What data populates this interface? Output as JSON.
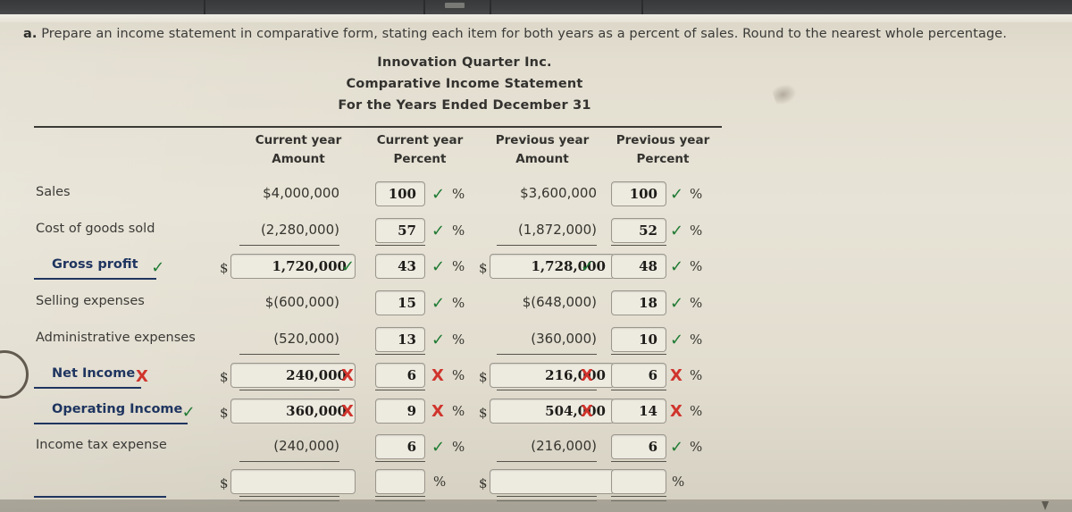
{
  "question": {
    "label": "a.",
    "text": "Prepare an income statement in comparative form, stating each item for both years as a percent of sales. Round to the nearest whole percentage."
  },
  "statement": {
    "company": "Innovation Quarter Inc.",
    "title": "Comparative Income Statement",
    "period": "For the Years Ended December 31",
    "columns": [
      {
        "line1": "Current year",
        "line2": "Amount"
      },
      {
        "line1": "Current year",
        "line2": "Percent"
      },
      {
        "line1": "Previous year",
        "line2": "Amount"
      },
      {
        "line1": "Previous year",
        "line2": "Percent"
      }
    ]
  },
  "symbols": {
    "dollar": "$",
    "percent": "%",
    "check": "✓",
    "cross": "X"
  },
  "rows": [
    {
      "label": "Sales",
      "bold": false,
      "cur_amount_text": "$4,000,000",
      "cur_amount_input": null,
      "cur_amount_mark": null,
      "cur_percent_input": "100",
      "cur_percent_mark": "check",
      "prev_amount_text": "$3,600,000",
      "prev_amount_input": null,
      "prev_amount_mark": null,
      "prev_percent_input": "100",
      "prev_percent_mark": "check"
    },
    {
      "label": "Cost of goods sold",
      "bold": false,
      "cur_amount_text": "(2,280,000)",
      "cur_amount_input": null,
      "cur_amount_mark": null,
      "cur_percent_input": "57",
      "cur_percent_mark": "check",
      "prev_amount_text": "(1,872,000)",
      "prev_amount_input": null,
      "prev_amount_mark": null,
      "prev_percent_input": "52",
      "prev_percent_mark": "check"
    },
    {
      "label": "Gross profit",
      "bold": true,
      "label_mark": "check",
      "cur_amount_text": null,
      "cur_amount_input": "1,720,000",
      "cur_amount_mark": "check",
      "cur_percent_input": "43",
      "cur_percent_mark": "check",
      "prev_amount_text": null,
      "prev_amount_input": "1,728,000",
      "prev_amount_mark": "check",
      "prev_percent_input": "48",
      "prev_percent_mark": "check"
    },
    {
      "label": "Selling expenses",
      "bold": false,
      "cur_amount_text": "$(600,000)",
      "cur_amount_input": null,
      "cur_amount_mark": null,
      "cur_percent_input": "15",
      "cur_percent_mark": "check",
      "prev_amount_text": "$(648,000)",
      "prev_amount_input": null,
      "prev_amount_mark": null,
      "prev_percent_input": "18",
      "prev_percent_mark": "check"
    },
    {
      "label": "Administrative expenses",
      "bold": false,
      "cur_amount_text": "(520,000)",
      "cur_amount_input": null,
      "cur_amount_mark": null,
      "cur_percent_input": "13",
      "cur_percent_mark": "check",
      "prev_amount_text": "(360,000)",
      "prev_amount_input": null,
      "prev_amount_mark": null,
      "prev_percent_input": "10",
      "prev_percent_mark": "check"
    },
    {
      "label": "Net Income",
      "bold": true,
      "label_mark": "cross",
      "cur_amount_text": null,
      "cur_amount_input": "240,000",
      "cur_amount_mark": "cross",
      "cur_percent_input": "6",
      "cur_percent_mark": "cross",
      "prev_amount_text": null,
      "prev_amount_input": "216,000",
      "prev_amount_mark": "cross",
      "prev_percent_input": "6",
      "prev_percent_mark": "cross"
    },
    {
      "label": "Operating Income",
      "bold": true,
      "label_mark": "check",
      "cur_amount_text": null,
      "cur_amount_input": "360,000",
      "cur_amount_mark": "cross",
      "cur_percent_input": "9",
      "cur_percent_mark": "cross",
      "prev_amount_text": null,
      "prev_amount_input": "504,000",
      "prev_amount_mark": "cross",
      "prev_percent_input": "14",
      "prev_percent_mark": "cross"
    },
    {
      "label": "Income tax expense",
      "bold": false,
      "cur_amount_text": "(240,000)",
      "cur_amount_input": null,
      "cur_amount_mark": null,
      "cur_percent_input": "6",
      "cur_percent_mark": "check",
      "prev_amount_text": "(216,000)",
      "prev_amount_input": null,
      "prev_amount_mark": null,
      "prev_percent_input": "6",
      "prev_percent_mark": "check"
    },
    {
      "label": "",
      "bold": true,
      "label_mark": null,
      "cur_amount_text": null,
      "cur_amount_input": "",
      "cur_amount_mark": null,
      "cur_percent_input": "",
      "cur_percent_mark": null,
      "prev_amount_text": null,
      "prev_amount_input": "",
      "prev_amount_mark": null,
      "prev_percent_input": "",
      "prev_percent_mark": null
    }
  ],
  "colors": {
    "correct": "#1f7a33",
    "incorrect": "#d0342c",
    "bold_label": "#1f3560",
    "paper": "#e5e0d2"
  }
}
